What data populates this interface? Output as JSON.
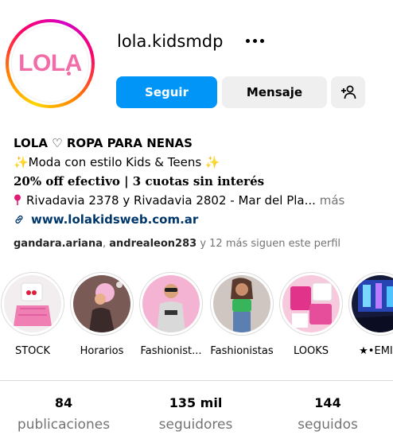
{
  "profile": {
    "username": "lola.kidsmdp",
    "avatar_logo": "LOLA",
    "name": "LOLA ♡ ROPA PARA NENAS",
    "bio_line1": "✨Moda con estilo Kids & Teens ✨",
    "bio_line2": "20% off efectivo | 3 cuotas sin interés",
    "bio_line3": "Rivadavia 2378 y Rivadavia 2802 - Mar del Pla...",
    "more_label": "más",
    "link": "www.lolakidsweb.com.ar"
  },
  "buttons": {
    "follow": "Seguir",
    "message": "Mensaje"
  },
  "followed_by": {
    "user1": "gandara.ariana",
    "sep": ", ",
    "user2": "andrealeon283",
    "suffix": " y 12 más siguen este perfil"
  },
  "highlights": [
    {
      "label": "STOCK"
    },
    {
      "label": "Horarios"
    },
    {
      "label": "Fashionist..."
    },
    {
      "label": "Fashionistas"
    },
    {
      "label": "LOOKS"
    },
    {
      "label": "★•EMILI"
    }
  ],
  "stats": [
    {
      "value": "84",
      "label": "publicaciones"
    },
    {
      "value": "135 mil",
      "label": "seguidores"
    },
    {
      "value": "144",
      "label": "seguidos"
    }
  ],
  "colors": {
    "accent": "#0095f6",
    "logo_pink": "#f26ca7",
    "link": "#00376b",
    "muted": "#737373",
    "button_gray": "#efefef"
  },
  "icons": [
    "more-icon",
    "add-user-icon",
    "location-pin-icon",
    "link-icon"
  ]
}
